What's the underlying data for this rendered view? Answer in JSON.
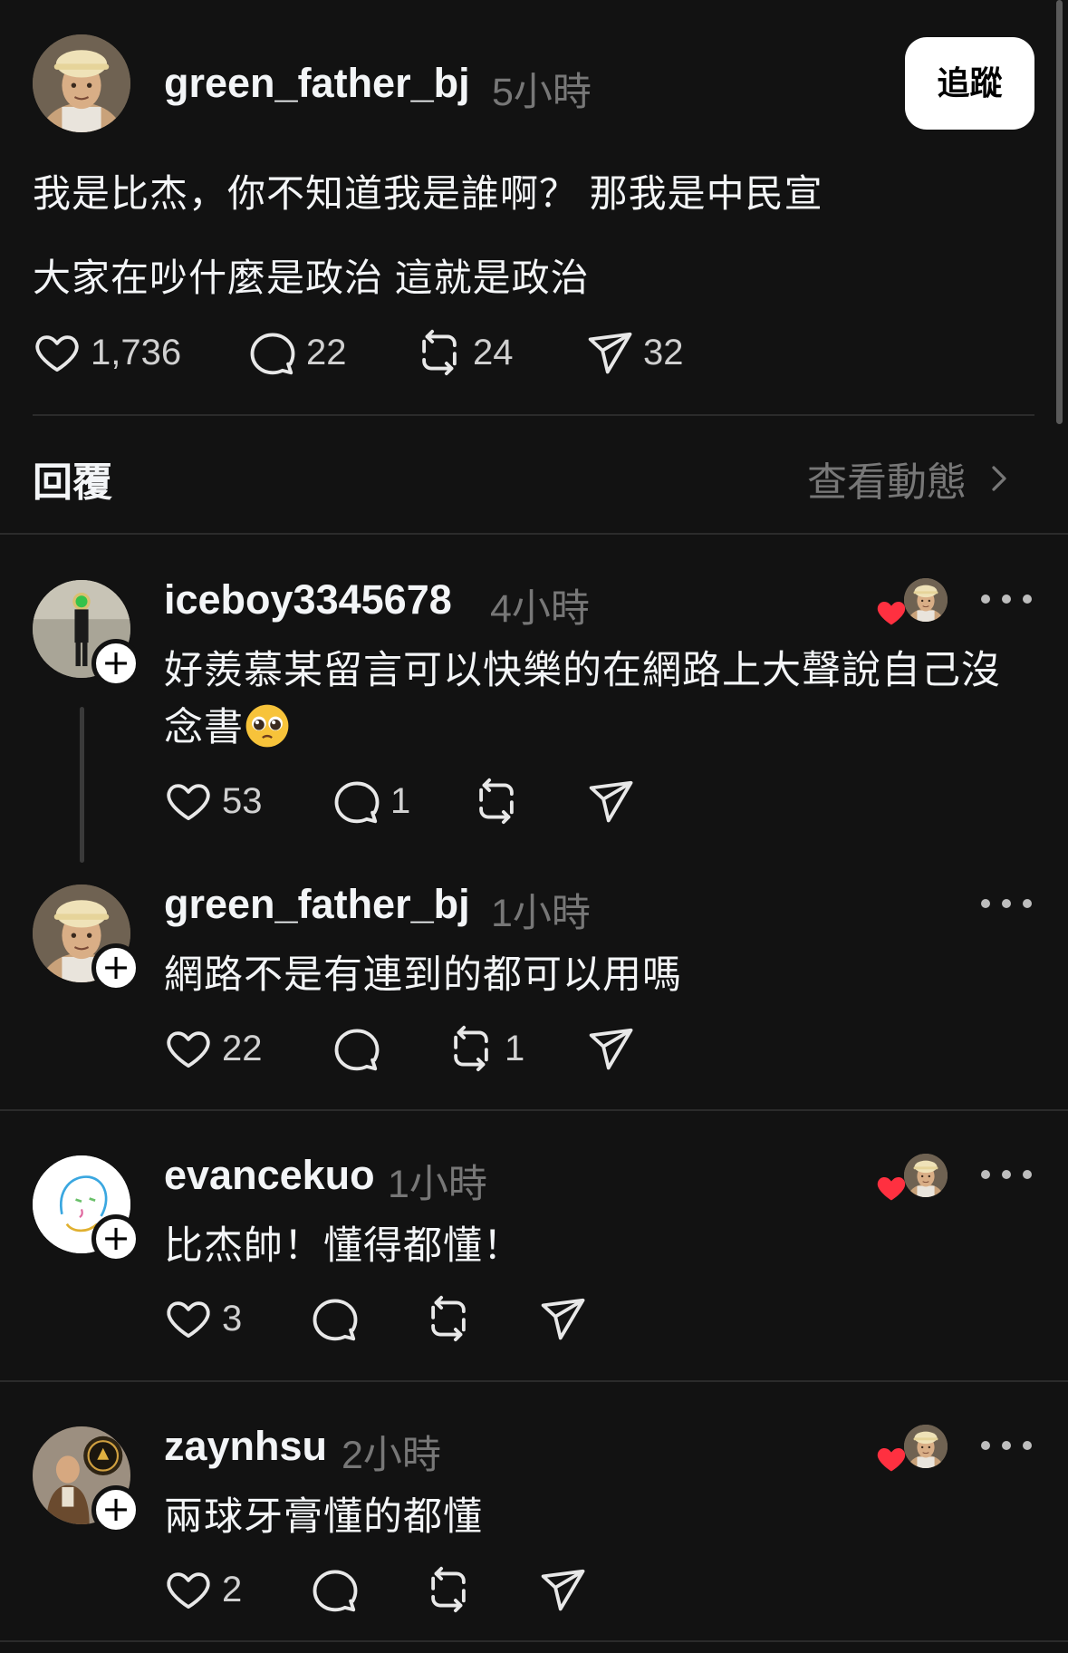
{
  "post": {
    "username": "green_father_bj",
    "time": "5小時",
    "follow_label": "追蹤",
    "line1": "我是比杰，你不知道我是誰啊？  那我是中民宣",
    "line2": "大家在吵什麼是政治 這就是政治",
    "likes": "1,736",
    "comments": "22",
    "reposts": "24",
    "shares": "32"
  },
  "section": {
    "replies_label": "回覆",
    "activity_label": "查看動態"
  },
  "replies": [
    {
      "username": "iceboy3345678",
      "time": "4小時",
      "text_line1": "好羨慕某留言可以快樂的在網路上大聲說自己沒",
      "text_line2": "念書",
      "emoji": "pleading-face",
      "likes": "53",
      "comments": "1",
      "reposts": "",
      "author_liked": true
    },
    {
      "username": "green_father_bj",
      "time": "1小時",
      "text_line1": "網路不是有連到的都可以用嗎",
      "likes": "22",
      "comments": "",
      "reposts": "1",
      "author_liked": false
    },
    {
      "username": "evancekuo",
      "time": "1小時",
      "text_line1": "比杰帥！懂得都懂！",
      "likes": "3",
      "comments": "",
      "reposts": "",
      "author_liked": true
    },
    {
      "username": "zaynhsu",
      "time": "2小時",
      "text_line1": "兩球牙膏懂的都懂",
      "likes": "2",
      "comments": "",
      "reposts": "",
      "author_liked": true
    }
  ],
  "colors": {
    "background": "#121212",
    "text": "#f3f5f7",
    "muted": "#777777",
    "heart": "#ff3040"
  }
}
